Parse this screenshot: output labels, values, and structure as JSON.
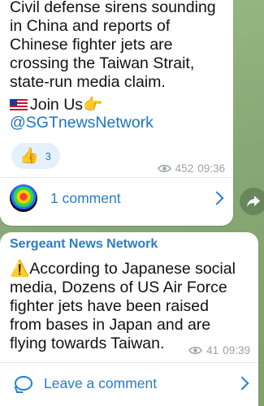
{
  "post1": {
    "text": "Civil defense sirens sounding\nin China and reports of\nChinese fighter jets are\ncrossing the Taiwan Strait,\nstate-run media claim.",
    "join_text": "Join Us",
    "join_pointer": "👉",
    "handle": "@SGTnewsNetwork",
    "reaction": {
      "emoji": "👍",
      "count": "3"
    },
    "views": "452",
    "time": "09:36",
    "comments_label": "1 comment"
  },
  "post2": {
    "author": "Sergeant News Network",
    "warning_icon": "⚠️",
    "text": "According to Japanese social\nmedia, Dozens of US Air Force\nfighter jets have been raised\nfrom bases in Japan and are\nflying towards Taiwan.",
    "views": "41",
    "time": "09:39",
    "comments_label": "Leave a comment"
  },
  "colors": {
    "link_blue": "#2a7cc7",
    "meta_gray": "#9aa3ab",
    "bubble_bg": "#ffffff",
    "wallpaper": "#8fb07c"
  },
  "icons": {
    "flag": "us-flag-icon",
    "eye": "eye-icon",
    "chevron": "chevron-right-icon",
    "share": "share-icon",
    "comment": "comment-bubble-icon"
  }
}
